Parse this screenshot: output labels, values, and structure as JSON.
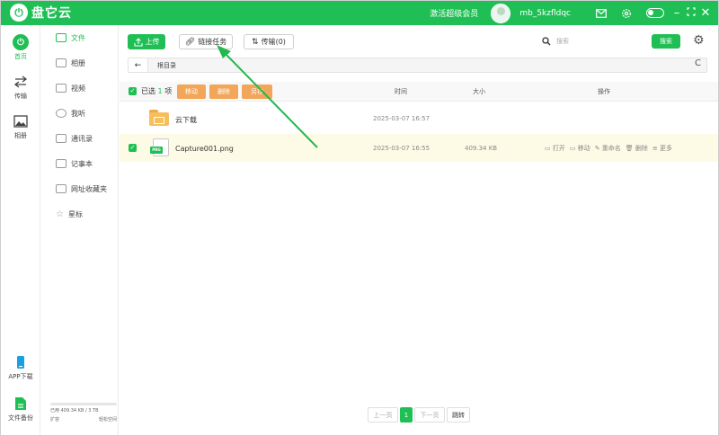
{
  "app": {
    "logo_mark": "⏻",
    "name": "盘它云"
  },
  "titlebar": {
    "vip_link": "激活超级会员",
    "username": "mb_5kzfldqc",
    "icons": [
      "mail-icon",
      "settings-icon",
      "theme-toggle",
      "minimize-icon",
      "maximize-icon",
      "close-icon"
    ]
  },
  "rail": [
    {
      "label": "首页",
      "icon": "home-icon",
      "active": true
    },
    {
      "label": "传输",
      "icon": "transfer-icon"
    },
    {
      "label": "相册",
      "icon": "album-icon"
    },
    {
      "label": "APP下载",
      "icon": "phone-icon"
    },
    {
      "label": "文件备份",
      "icon": "backup-icon"
    }
  ],
  "sidebar": {
    "items": [
      {
        "label": "文件",
        "icon": "file-icon",
        "active": true
      },
      {
        "label": "相册",
        "icon": "photo-icon"
      },
      {
        "label": "视频",
        "icon": "video-icon"
      },
      {
        "label": "我听",
        "icon": "audio-icon"
      },
      {
        "label": "通讯录",
        "icon": "contacts-icon"
      },
      {
        "label": "记事本",
        "icon": "notepad-icon"
      },
      {
        "label": "网址收藏夹",
        "icon": "bookmark-icon"
      },
      {
        "label": "星标",
        "icon": "star-icon"
      }
    ],
    "storage": {
      "used_text": "已用 409.34 KB / 3 TB",
      "expand": "扩容",
      "free": "轻松空间"
    }
  },
  "toolbar": {
    "upload": "上传",
    "link_task": "链接任务",
    "transfer": "传输(0)",
    "search_placeholder": "搜索",
    "search_button": "搜索"
  },
  "path": {
    "back": "←",
    "crumb": "根目录",
    "refresh": "C"
  },
  "table": {
    "selected_prefix": "已选",
    "selected_count": "1",
    "selected_suffix": "项",
    "bulk_actions": [
      "移动",
      "删除",
      "另存"
    ],
    "headers": {
      "time": "时间",
      "size": "大小",
      "actions": "操作"
    },
    "rows": [
      {
        "name": "云下载",
        "type": "folder",
        "time": "2025-03-07 16:57",
        "size": "",
        "selected": false
      },
      {
        "name": "Capture001.png",
        "type": "png",
        "time": "2025-03-07 16:55",
        "size": "409.34 KB",
        "selected": true,
        "actions": [
          "打开",
          "移动",
          "重命名",
          "删除",
          "更多"
        ]
      }
    ],
    "png_badge": "PNG"
  },
  "pager": {
    "prev": "上一页",
    "current": "1",
    "next": "下一页",
    "jump": "跳转"
  },
  "colors": {
    "brand": "#20bf55",
    "orange": "#f2a65a",
    "selected_row": "#fdfbe6"
  }
}
